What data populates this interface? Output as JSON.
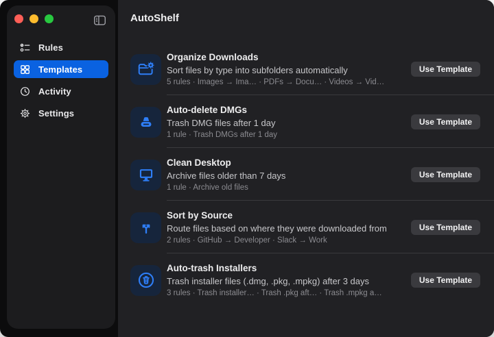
{
  "app": {
    "name": "AutoShelf"
  },
  "titlebar": {
    "traffic_lights": [
      {
        "name": "close",
        "color": "#ff5f57"
      },
      {
        "name": "minimize",
        "color": "#febc2e"
      },
      {
        "name": "zoom",
        "color": "#28c840"
      }
    ]
  },
  "sidebar": {
    "items": [
      {
        "label": "Rules",
        "icon": "checklist-icon",
        "selected": false
      },
      {
        "label": "Templates",
        "icon": "grid-icon",
        "selected": true
      },
      {
        "label": "Activity",
        "icon": "clock-icon",
        "selected": false
      },
      {
        "label": "Settings",
        "icon": "gear-icon",
        "selected": false
      }
    ]
  },
  "header": {
    "title": "AutoShelf"
  },
  "templates": [
    {
      "name": "Organize Downloads",
      "description": "Sort files by type into subfolders automatically",
      "meta": "5 rules · Images → Ima… · PDFs → Docu… · Videos → Vid…",
      "icon": "folder-gear-icon",
      "button": "Use Template"
    },
    {
      "name": "Auto-delete DMGs",
      "description": "Trash DMG files after 1 day",
      "meta": "1 rule · Trash DMGs after 1 day",
      "icon": "drive-icon",
      "button": "Use Template"
    },
    {
      "name": "Clean Desktop",
      "description": "Archive files older than 7 days",
      "meta": "1 rule · Archive old files",
      "icon": "display-icon",
      "button": "Use Template"
    },
    {
      "name": "Sort by Source",
      "description": "Route files based on where they were downloaded from",
      "meta": "2 rules · GitHub → Developer · Slack → Work",
      "icon": "branch-icon",
      "button": "Use Template"
    },
    {
      "name": "Auto-trash Installers",
      "description": "Trash installer files (.dmg, .pkg, .mpkg) after 3 days",
      "meta": "3 rules · Trash installer… · Trash .pkg aft… · Trash .mpkg a…",
      "icon": "trash-circle-icon",
      "button": "Use Template"
    }
  ],
  "colors": {
    "accent_blue": "#0a62e1",
    "icon_blue": "#2e7ef7",
    "icon_tile_bg": "#16253c",
    "sidebar_bg": "#1c1c1e",
    "main_bg": "#212124",
    "window_frame": "#0c0c0d",
    "divider": "#3a3a3d",
    "button_bg": "#3a3a3e"
  }
}
